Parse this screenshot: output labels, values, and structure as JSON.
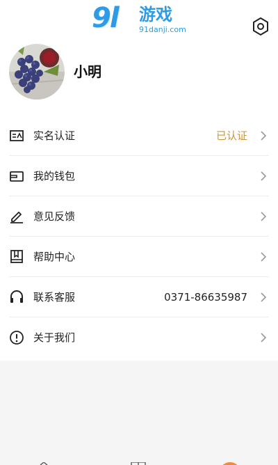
{
  "watermark": {
    "logo": "9l",
    "cn": "游戏",
    "url": "91danji.com"
  },
  "header": {
    "settings_icon": "hexagon-gear-icon"
  },
  "profile": {
    "username": "小明",
    "avatar": "grapes-photo"
  },
  "menu": {
    "items": [
      {
        "id": "real-name",
        "icon": "id-card-icon",
        "label": "实名认证",
        "value": "已认证"
      },
      {
        "id": "wallet",
        "icon": "wallet-icon",
        "label": "我的钱包",
        "value": ""
      },
      {
        "id": "feedback",
        "icon": "pen-icon",
        "label": "意见反馈",
        "value": ""
      },
      {
        "id": "help",
        "icon": "book-icon",
        "label": "帮助中心",
        "value": ""
      },
      {
        "id": "service",
        "icon": "headset-icon",
        "label": "联系客服",
        "value": "0371-86635987"
      },
      {
        "id": "about",
        "icon": "info-icon",
        "label": "关于我们",
        "value": ""
      }
    ]
  },
  "colors": {
    "verified": "#c8963e",
    "watermark": "#2f9be6",
    "accent": "#f08a3c"
  }
}
